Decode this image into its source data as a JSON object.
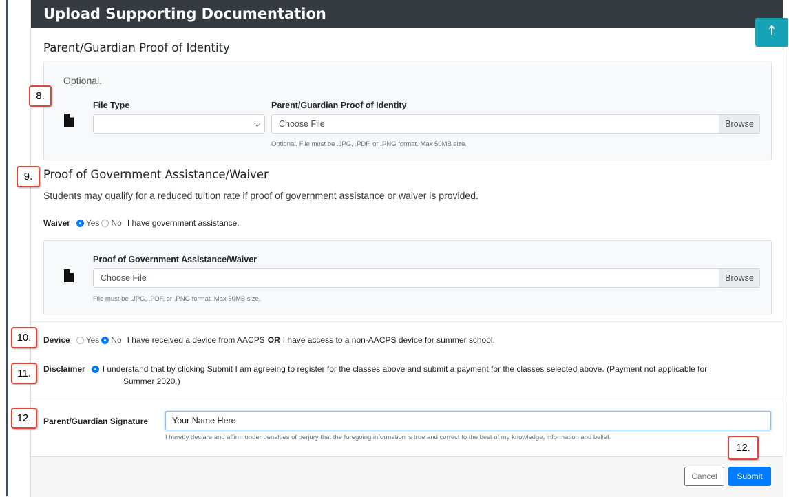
{
  "header": {
    "title": "Upload Supporting Documentation"
  },
  "scroll_top": {
    "icon": "arrow-up-icon",
    "glyph": "🡑"
  },
  "parent_id_section": {
    "title": "Parent/Guardian Proof of Identity",
    "optional_note": "Optional.",
    "file_type_label": "File Type",
    "file_type_value": "",
    "file_label": "Parent/Guardian Proof of Identity",
    "file_placeholder": "Choose File",
    "browse_label": "Browse",
    "help": "Optional. File must be .JPG, .PDF, or .PNG format. Max 50MB size."
  },
  "waiver_section": {
    "title": "Proof of Government Assistance/Waiver",
    "description": "Students may qualify for a reduced tuition rate if proof of government assistance or waiver is provided.",
    "radio_label": "Waiver",
    "yes": "Yes",
    "no": "No",
    "selected": "Yes",
    "statement": "I have government assistance.",
    "file_label": "Proof of Government Assistance/Waiver",
    "file_placeholder": "Choose File",
    "browse_label": "Browse",
    "help": "File must be .JPG, .PDF, or .PNG format. Max 50MB size."
  },
  "device": {
    "label": "Device",
    "yes": "Yes",
    "no": "No",
    "selected": "No",
    "statement_a": "I have received a device from AACPS",
    "statement_or": "OR",
    "statement_b": "I have access to a non-AACPS device for summer school."
  },
  "disclaimer": {
    "label": "Disclaimer",
    "line1": "I understand that by clicking Submit I am agreeing to register for the classes above and submit a payment for the classes selected above. (Payment not applicable for",
    "line2": "Summer 2020.)"
  },
  "signature": {
    "label": "Parent/Guardian Signature",
    "value": "Your Name Here",
    "help": "I hereby declare and affirm under penalties of perjury that the foregoing information is true and correct to the best of my knowledge, information and belief."
  },
  "footer": {
    "cancel": "Cancel",
    "submit": "Submit"
  },
  "callouts": {
    "c8": "8.",
    "c9": "9.",
    "c10": "10.",
    "c11": "11.",
    "c12a": "12.",
    "c12b": "12."
  },
  "colors": {
    "header_bg": "#343a40",
    "primary": "#007bff",
    "callout_border": "#e2463b",
    "scroll_btn": "#17a2b8"
  }
}
